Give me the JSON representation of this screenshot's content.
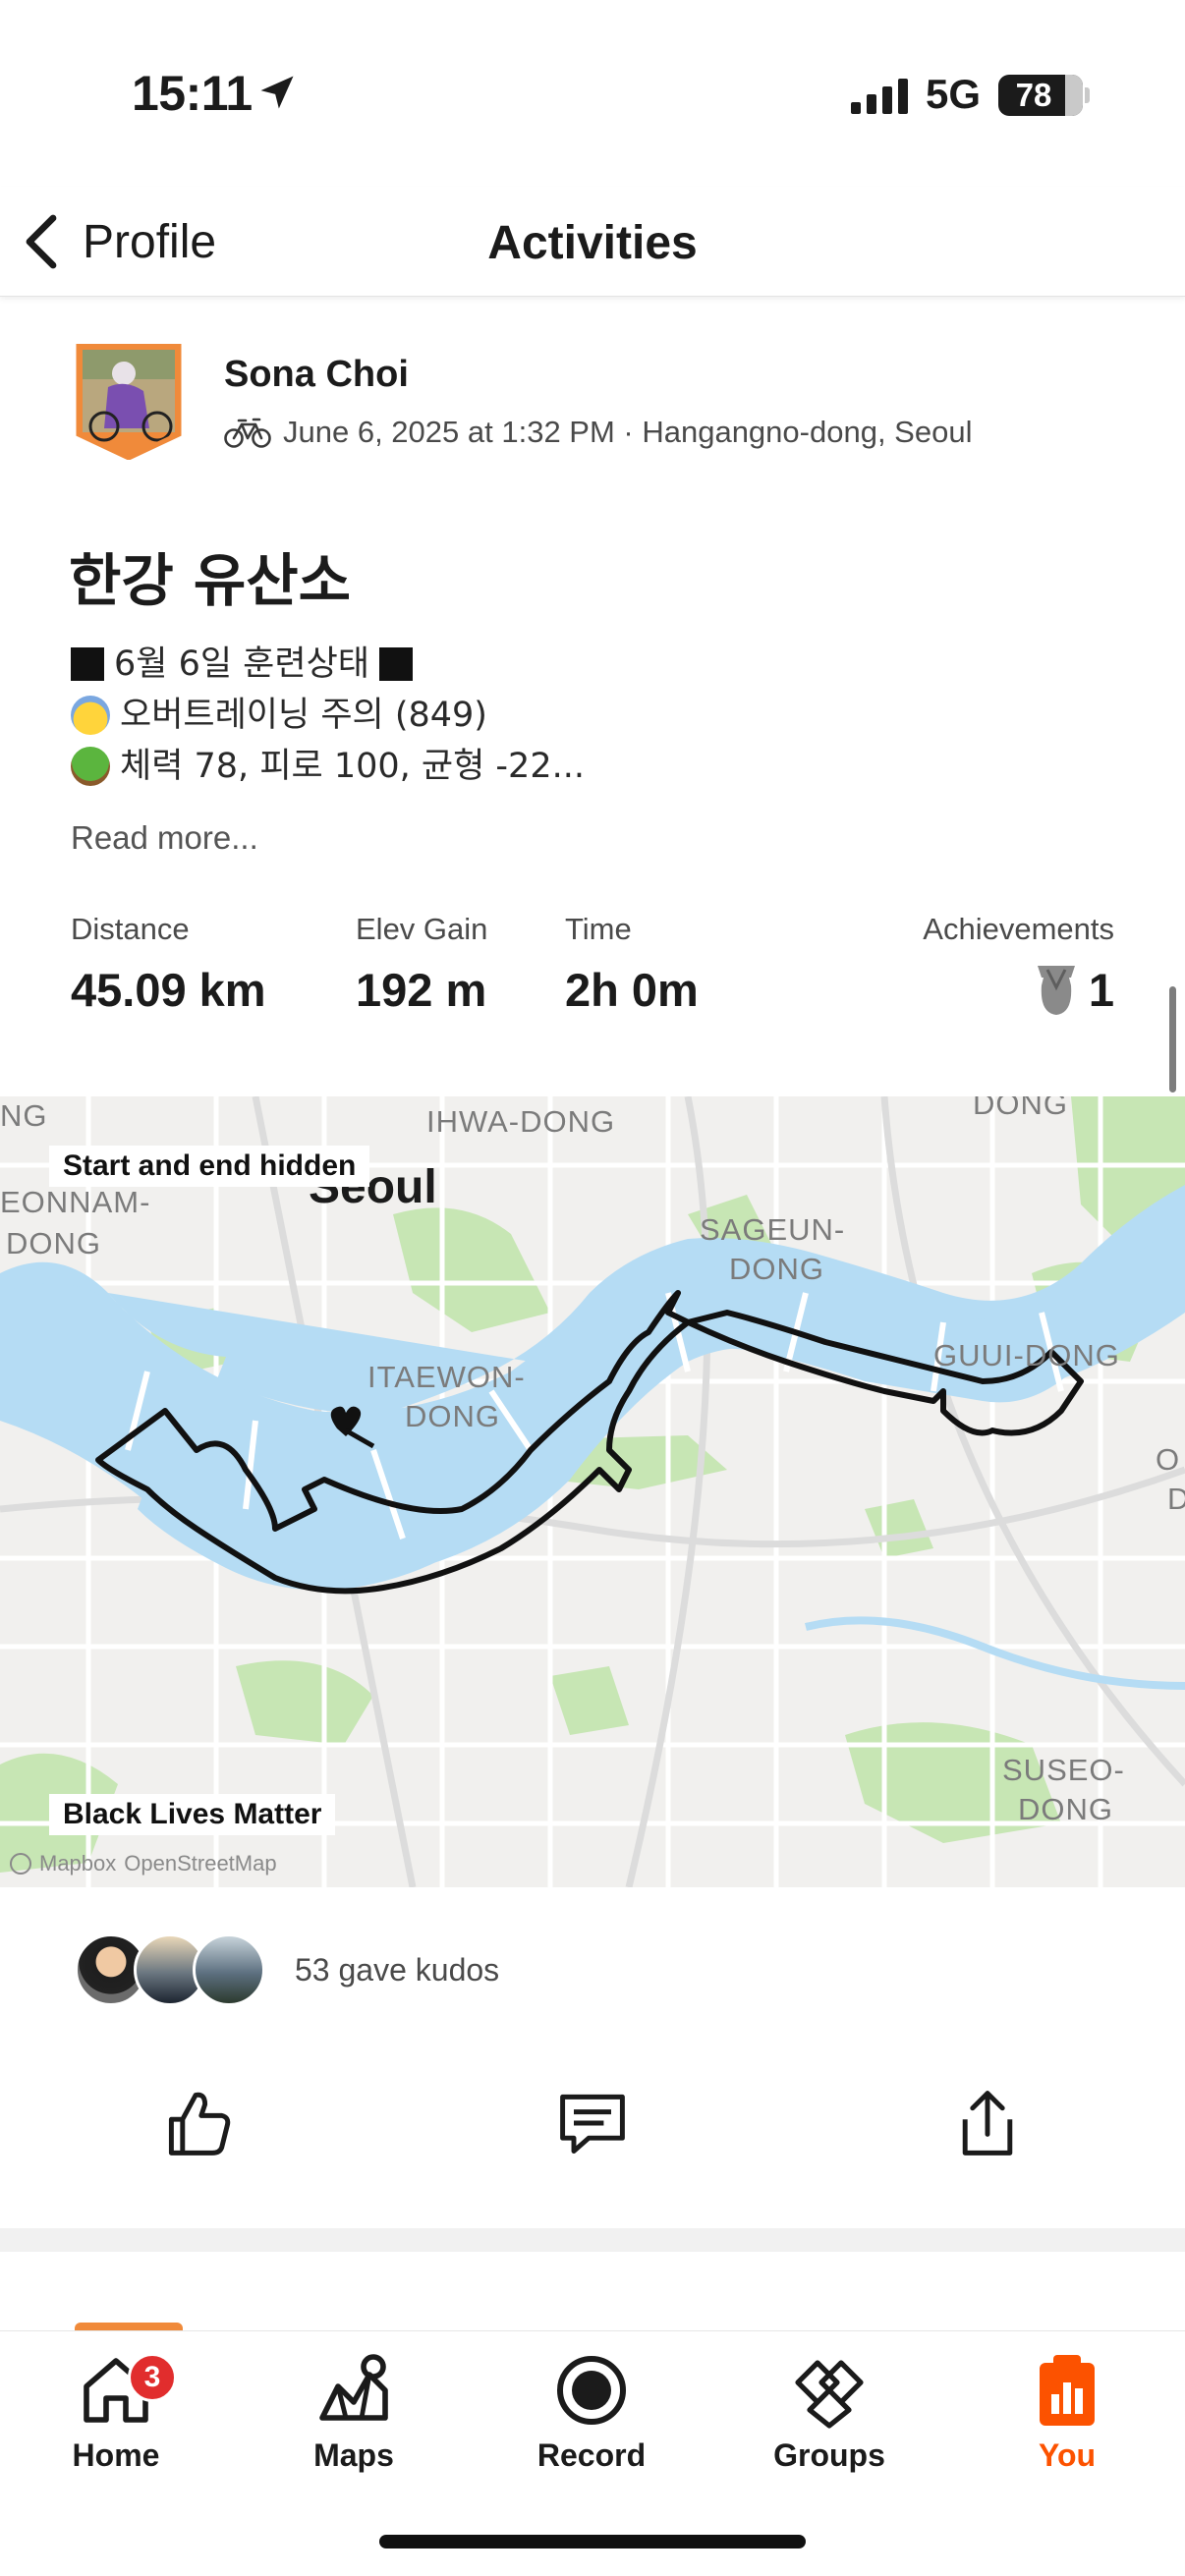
{
  "status_bar": {
    "time": "15:11",
    "network": "5G",
    "battery": "78"
  },
  "nav": {
    "back_label": "Profile",
    "title": "Activities"
  },
  "activity": {
    "athlete_name": "Sona Choi",
    "meta": "June 6, 2025 at 1:32 PM · Hangangno-dong, Seoul",
    "title": "한강 유산소",
    "description_lines": [
      "6월 6일 훈련상태",
      "오버트레이닝 주의 (849)",
      "체력 78, 피로 100, 균형 -22..."
    ],
    "read_more": "Read more...",
    "stats": [
      {
        "label": "Distance",
        "value": "45.09 km"
      },
      {
        "label": "Elev Gain",
        "value": "192 m"
      },
      {
        "label": "Time",
        "value": "2h 0m"
      }
    ],
    "achievements": {
      "label": "Achievements",
      "count": "1"
    }
  },
  "map": {
    "start_end_badge": "Start and end hidden",
    "bottom_badge": "Black Lives Matter",
    "attribution": [
      "Mapbox",
      "OpenStreetMap"
    ],
    "labels": {
      "ihwa": "IHWA-DONG",
      "seoul": "Seoul",
      "ng": "NG",
      "yeonnam1": "EONNAM-",
      "yeonnam2": "DONG",
      "sageun1": "SAGEUN-",
      "sageun2": "DONG",
      "itaewon1": "ITAEWON-",
      "itaewon2": "DONG",
      "guui": "GUUI-DONG",
      "dong_top": "DONG",
      "suseo1": "SUSEO-",
      "suseo2": "DONG",
      "o_right": "O",
      "d_right": "D"
    },
    "colors": {
      "water": "#b5dcf4",
      "park": "#c7e6b4",
      "route": "#111111",
      "road": "#ffffff"
    }
  },
  "kudos": {
    "text": "53 gave kudos"
  },
  "tabs": [
    {
      "label": "Home",
      "badge": "3"
    },
    {
      "label": "Maps"
    },
    {
      "label": "Record"
    },
    {
      "label": "Groups"
    },
    {
      "label": "You",
      "active": true
    }
  ],
  "colors": {
    "accent": "#fc5200",
    "badge": "#e12d2d"
  },
  "icons": [
    "location-arrow-icon",
    "signal-icon",
    "chevron-left-icon",
    "bike-icon",
    "trophy-icon",
    "thumbs-up-icon",
    "comment-icon",
    "share-icon",
    "home-icon",
    "maps-icon",
    "record-icon",
    "groups-icon",
    "you-icon"
  ]
}
